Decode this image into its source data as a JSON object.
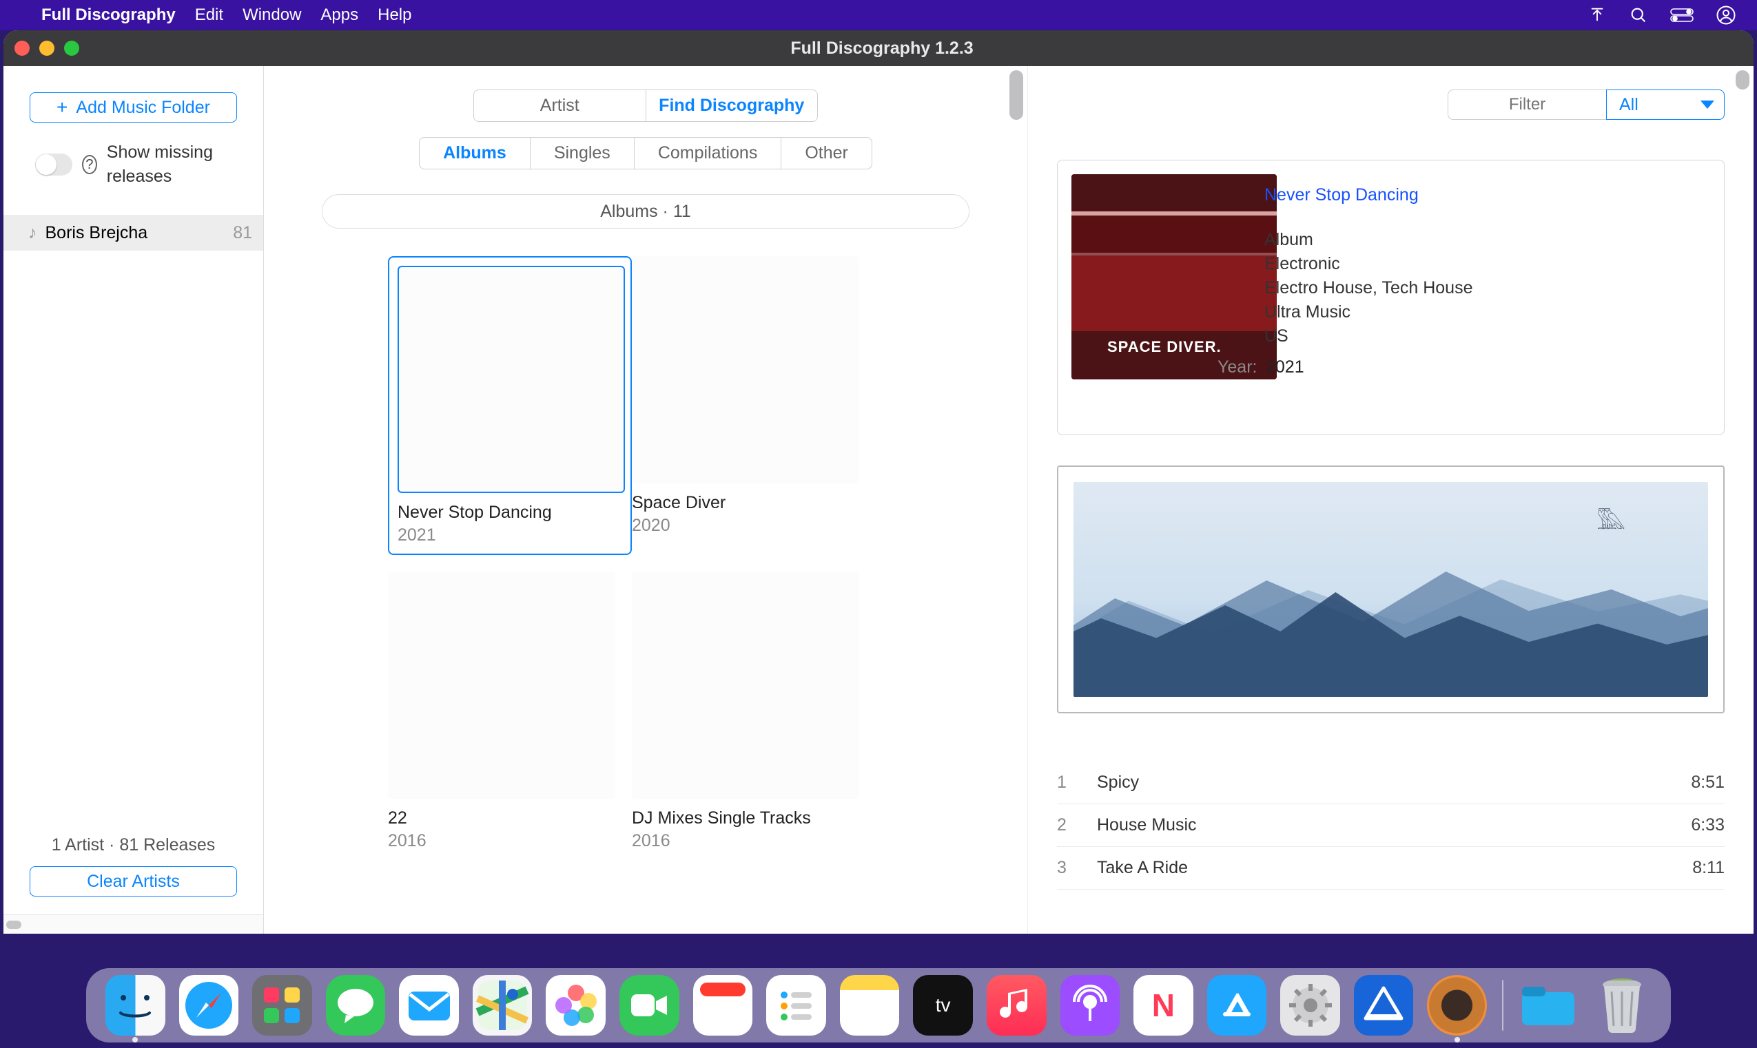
{
  "menubar": {
    "app_name": "Full Discography",
    "items": [
      "Edit",
      "Window",
      "Apps",
      "Help"
    ]
  },
  "window": {
    "title": "Full Discography 1.2.3"
  },
  "sidebar": {
    "add_button": "Add Music Folder",
    "toggle_label": "Show missing releases",
    "artists": [
      {
        "name": "Boris Brejcha",
        "count": "81"
      }
    ],
    "footer_summary": "1 Artist · 81 Releases",
    "clear_button": "Clear Artists"
  },
  "middle": {
    "top_seg": {
      "left": "Artist",
      "right": "Find Discography",
      "active": "right"
    },
    "type_seg": {
      "options": [
        "Albums",
        "Singles",
        "Compilations",
        "Other"
      ],
      "active": 0
    },
    "pill_label": "Albums · 11",
    "albums": [
      {
        "title": "Never Stop Dancing",
        "year": "2021",
        "selected": true
      },
      {
        "title": "Space Diver",
        "year": "2020",
        "selected": false
      },
      {
        "title": "22",
        "year": "2016",
        "selected": false
      },
      {
        "title": "DJ Mixes Single Tracks",
        "year": "2016",
        "selected": false
      }
    ]
  },
  "right": {
    "filter_placeholder": "Filter",
    "select_label": "All",
    "info": {
      "title_link": "Never Stop Dancing",
      "cover_text": "SPACE DIVER.",
      "fields": {
        "type": "Album",
        "genre": "Electronic",
        "style": "Electro House, Tech House",
        "label": "Ultra Music",
        "country": "US",
        "year_label": "Year:",
        "year": "2021"
      }
    },
    "tracks": [
      {
        "n": "1",
        "title": "Spicy",
        "dur": "8:51"
      },
      {
        "n": "2",
        "title": "House Music",
        "dur": "6:33"
      },
      {
        "n": "3",
        "title": "Take A Ride",
        "dur": "8:11"
      }
    ]
  }
}
